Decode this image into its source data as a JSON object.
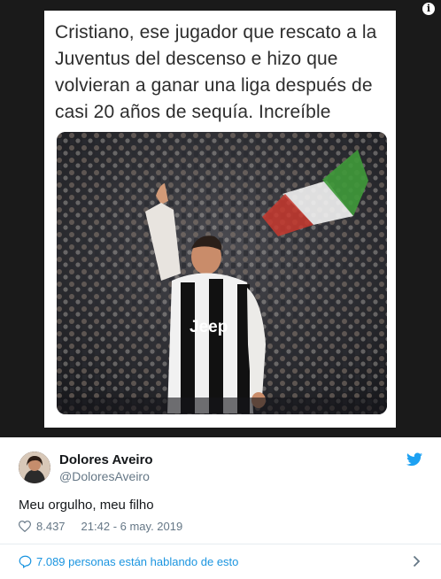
{
  "media": {
    "info_icon": "info-icon",
    "meme_text": "Cristiano, ese jugador que rescato a la Juventus del descenso e hizo que volvieran a ganar una liga después de casi 20 años de sequía. Increíble",
    "photo_jersey_text": "Jeep"
  },
  "tweet": {
    "display_name": "Dolores Aveiro",
    "handle": "@DoloresAveiro",
    "text": "Meu orgulho, meu filho",
    "likes": "8.437",
    "timestamp": "21:42 - 6 may. 2019",
    "talking": "7.089 personas están hablando de esto"
  },
  "colors": {
    "twitter_blue": "#1da1f2",
    "link_blue": "#1b95e0",
    "muted": "#657786",
    "text": "#14171a"
  }
}
